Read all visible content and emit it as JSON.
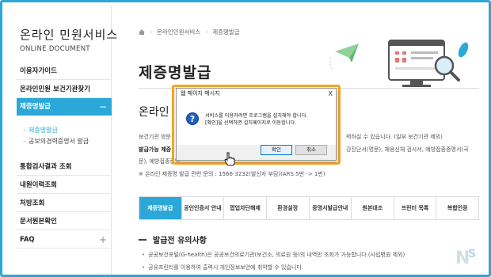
{
  "sidebar": {
    "brand_title": "온라인 민원서비스",
    "brand_subtitle": "ONLINE DOCUMENT",
    "menu": [
      {
        "label": "이용자가이드",
        "toggle": ""
      },
      {
        "label": "온라인민원 보건기관찾기",
        "toggle": ""
      },
      {
        "label": "제증명발급",
        "toggle": "−"
      },
      {
        "label": "통합검사결과 조회",
        "toggle": ""
      },
      {
        "label": "내원이력조회",
        "toggle": ""
      },
      {
        "label": "처방조회",
        "toggle": ""
      },
      {
        "label": "문서원본확인",
        "toggle": ""
      },
      {
        "label": "FAQ",
        "toggle": "+"
      }
    ],
    "submenu": [
      {
        "label": "제증명발급"
      },
      {
        "label": "공보의경력증명서 발급"
      }
    ]
  },
  "breadcrumb": [
    "온라인민원서비스",
    "제증명발급"
  ],
  "page_title": "제증명발급",
  "section_title": "온라인",
  "body": {
    "line1_left": "보건기관 방문",
    "line1_right": "력하실 수 있습니다. (일부 보건기관 제외)",
    "line2_label": "발급가능 제증",
    "line2_right": "강진단서(명문), 채용신체 검사서, 예방접종증명서(국",
    "line3_left": "문), 예방접종증명",
    "line4": "※ 온라인 제증명 발급 관련 문의 : 1566-3232(발신자 부담)(ARS 5번 -> 1번)"
  },
  "tabs": [
    {
      "label": "제증명발급",
      "active": true
    },
    {
      "label": "공인인증서 안내",
      "active": false
    },
    {
      "label": "팝업차단해제",
      "active": false
    },
    {
      "label": "환경설정",
      "active": false
    },
    {
      "label": "증명서발급안내",
      "active": false
    },
    {
      "label": "원본대조",
      "active": false
    },
    {
      "label": "프린터 목록",
      "active": false
    },
    {
      "label": "복합인증",
      "active": false
    }
  ],
  "notice": {
    "heading": "발급전 유의사항",
    "bullets": [
      "공공보건포털(G-health)은 공공보건의료기관(보건소, 의료원 등)의 내역만 조회가 가능합니다.(사립병원 제외)",
      "공유프린터를 이용하여 출력시 개인정보보안에 취약할 수 있습니다."
    ]
  },
  "dialog": {
    "title": "웹 페이지 메시지",
    "close": "X",
    "icon": "question-icon",
    "message_line1": "서비스를 이용하려면 프로그램을 설치해야 합니다.",
    "message_line2": "[확인]을 선택하면 설치페이지로 이동합니다.",
    "ok_label": "확인",
    "cancel_label": "취소"
  },
  "colors": {
    "accent": "#2ba8d8",
    "highlight": "#f5a623",
    "plane": "#8fd39a"
  }
}
